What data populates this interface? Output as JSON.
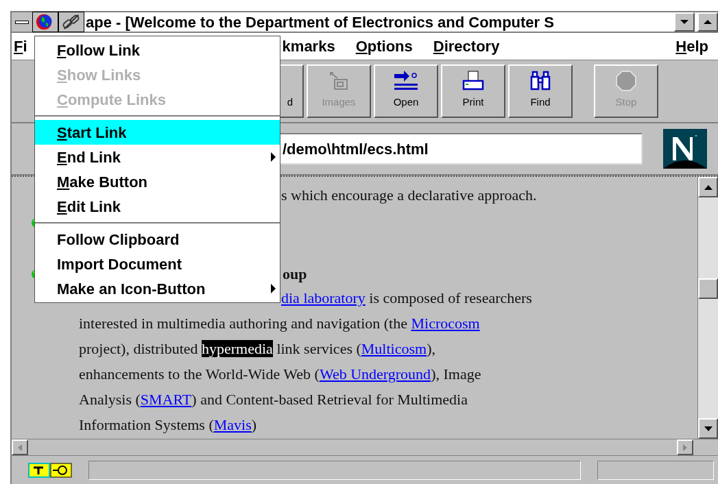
{
  "title_bar": {
    "title": "ape - [Welcome to the Department of Electronics and Computer S"
  },
  "menu_bar": [
    {
      "label": [
        {
          "text": "F",
          "underline": true
        },
        {
          "text": "i",
          "underline": false
        }
      ],
      "kind": "left"
    },
    {
      "label": [
        {
          "text": "kmarks",
          "underline": false
        }
      ],
      "kind": "left"
    },
    {
      "label": [
        {
          "text": "O",
          "underline": true
        },
        {
          "text": "ptions",
          "underline": false
        }
      ],
      "kind": "left"
    },
    {
      "label": [
        {
          "text": "D",
          "underline": true
        },
        {
          "text": "irectory",
          "underline": false
        }
      ],
      "kind": "left"
    },
    {
      "label": [
        {
          "text": "H",
          "underline": true
        },
        {
          "text": "elp",
          "underline": false
        }
      ],
      "kind": "right"
    }
  ],
  "toolbar": [
    {
      "label": "d",
      "kind": "partial",
      "disabled": false
    },
    {
      "label": "Images",
      "kind": "images",
      "disabled": true
    },
    {
      "label": "Open",
      "kind": "open",
      "disabled": false
    },
    {
      "label": "Print",
      "kind": "print",
      "disabled": false
    },
    {
      "label": "Find",
      "kind": "find",
      "disabled": false
    },
    {
      "label": "Stop",
      "kind": "stop",
      "disabled": true
    }
  ],
  "location": {
    "value": "/demo\\html/ecs.html"
  },
  "content": [
    {
      "kind": "covered",
      "segments": [
        {
          "kind": "text",
          "text": "s which encourage a declarative approach."
        }
      ]
    },
    {
      "kind": "bullet"
    },
    {
      "kind": "gap"
    },
    {
      "kind": "bullet-heading",
      "segments": [
        {
          "kind": "bold",
          "text": "oup"
        }
      ]
    },
    {
      "kind": "covered",
      "segments": [
        {
          "kind": "link",
          "text": "dia laboratory"
        },
        {
          "kind": "text",
          "text": " is composed of researchers"
        }
      ]
    },
    {
      "kind": "line",
      "segments": [
        {
          "kind": "text",
          "text": "interested in multimedia authoring and navigation (the "
        },
        {
          "kind": "link",
          "text": "Microcosm"
        }
      ]
    },
    {
      "kind": "line",
      "segments": [
        {
          "kind": "text",
          "text": "project), distributed "
        },
        {
          "kind": "highlight",
          "text": "hypermedia"
        },
        {
          "kind": "text",
          "text": " link services ("
        },
        {
          "kind": "link",
          "text": "Multicosm"
        },
        {
          "kind": "text",
          "text": "),"
        }
      ]
    },
    {
      "kind": "line",
      "segments": [
        {
          "kind": "text",
          "text": "enhancements to the World-Wide Web ("
        },
        {
          "kind": "link",
          "text": "Web Underground"
        },
        {
          "kind": "text",
          "text": "), Image"
        }
      ]
    },
    {
      "kind": "line",
      "segments": [
        {
          "kind": "text",
          "text": "Analysis ("
        },
        {
          "kind": "link",
          "text": "SMART"
        },
        {
          "kind": "text",
          "text": ") and Content-based Retrieval for Multimedia"
        }
      ]
    },
    {
      "kind": "line",
      "segments": [
        {
          "kind": "text",
          "text": "Information Systems ("
        },
        {
          "kind": "link",
          "text": "Mavis"
        },
        {
          "kind": "text",
          "text": ")"
        }
      ]
    }
  ],
  "popup_menu": [
    {
      "label": [
        {
          "text": "F",
          "underline": true
        },
        {
          "text": "ollow Link",
          "underline": false
        }
      ],
      "disabled": false,
      "selected": false,
      "submenu": false,
      "kind": "item"
    },
    {
      "label": [
        {
          "text": "S",
          "underline": true
        },
        {
          "text": "how Links",
          "underline": false
        }
      ],
      "disabled": true,
      "selected": false,
      "submenu": false,
      "kind": "item"
    },
    {
      "label": [
        {
          "text": "C",
          "underline": true
        },
        {
          "text": "ompute Links",
          "underline": false
        }
      ],
      "disabled": true,
      "selected": false,
      "submenu": false,
      "kind": "item"
    },
    {
      "kind": "separator"
    },
    {
      "label": [
        {
          "text": "S",
          "underline": true
        },
        {
          "text": "tart Link",
          "underline": false
        }
      ],
      "disabled": false,
      "selected": true,
      "submenu": false,
      "kind": "item"
    },
    {
      "label": [
        {
          "text": "E",
          "underline": true
        },
        {
          "text": "nd Link",
          "underline": false
        }
      ],
      "disabled": false,
      "selected": false,
      "submenu": true,
      "kind": "item"
    },
    {
      "label": [
        {
          "text": "M",
          "underline": true
        },
        {
          "text": "ake Button",
          "underline": false
        }
      ],
      "disabled": false,
      "selected": false,
      "submenu": false,
      "kind": "item"
    },
    {
      "label": [
        {
          "text": "E",
          "underline": true
        },
        {
          "text": "dit Link",
          "underline": false
        }
      ],
      "disabled": false,
      "selected": false,
      "submenu": false,
      "kind": "item"
    },
    {
      "kind": "separator"
    },
    {
      "label": [
        {
          "text": "Follow Clipboard",
          "underline": false
        }
      ],
      "disabled": false,
      "selected": false,
      "submenu": false,
      "kind": "item"
    },
    {
      "label": [
        {
          "text": "Import Document",
          "underline": false
        }
      ],
      "disabled": false,
      "selected": false,
      "submenu": false,
      "kind": "item"
    },
    {
      "label": [
        {
          "text": "Make an Icon-Button",
          "underline": false
        }
      ],
      "disabled": false,
      "selected": false,
      "submenu": true,
      "kind": "item"
    }
  ]
}
